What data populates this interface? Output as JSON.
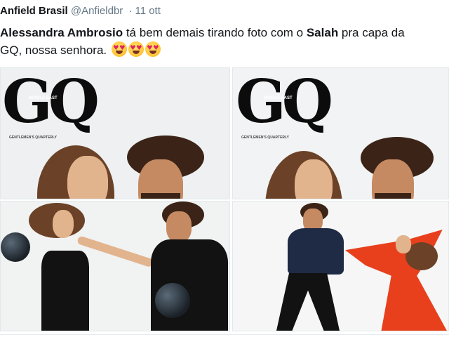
{
  "tweet": {
    "author_name": "Anfield Brasil",
    "author_handle": "@Anfieldbr",
    "separator": "·",
    "date": "11 ott",
    "text_part1": "Alessandra Ambrosio",
    "text_part2": " tá bem demais tirando foto com o ",
    "text_part3": "Salah",
    "text_part4": " pra capa da",
    "text_part5": "GQ, nossa senhora. ",
    "emoji": "smiling-face-with-heart-eyes"
  },
  "photos": [
    {
      "logo": "GQ",
      "tag": "MIDDLE EAST",
      "subline": "GENTLEMEN'S QUARTERLY"
    },
    {
      "logo": "GQ",
      "tag": "MIDDLE EAST",
      "subline": "GENTLEMEN'S QUARTERLY"
    },
    {},
    {}
  ],
  "colors": {
    "handle_gray": "#657786",
    "heart_red": "#e0245e",
    "emoji_yellow": "#ffc83d"
  }
}
